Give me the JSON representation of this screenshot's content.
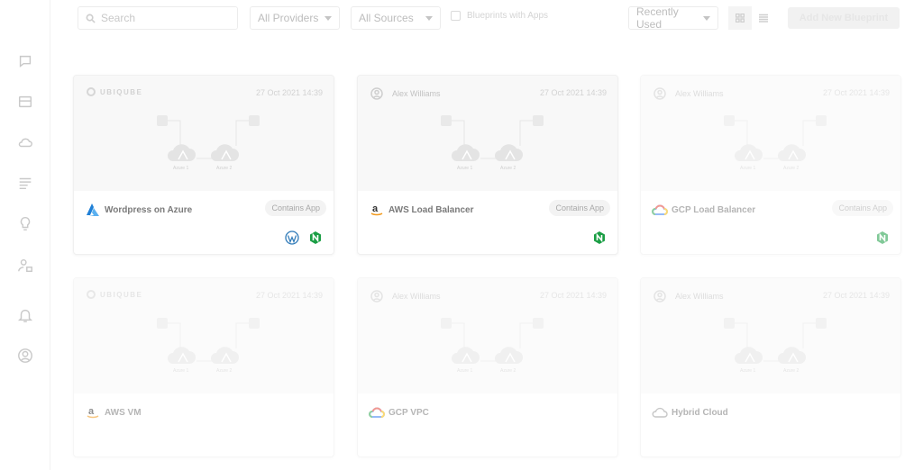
{
  "toolbar": {
    "search_placeholder": "Search",
    "providers_value": "All Providers",
    "sources_value": "All Sources",
    "checkbox_label": "Blueprints with Apps",
    "sort_value": "Recently Used",
    "add_button_label": "Add New Blueprint"
  },
  "sidebar": {
    "icons": [
      "chat-icon",
      "inbox-icon",
      "cloud-icon",
      "list-icon",
      "lightbulb-icon",
      "user-lock-icon",
      "bell-icon",
      "account-icon"
    ]
  },
  "diagram": {
    "node1_label": "Azure 1",
    "node2_label": "Azure 2"
  },
  "cards": [
    {
      "owner": "UBIQUBE",
      "owner_type": "logo",
      "date": "27 Oct 2021 14:39",
      "name": "Wordpress on Azure",
      "provider": "azure",
      "badge": "Contains App",
      "apps": [
        "wordpress",
        "nginx"
      ]
    },
    {
      "owner": "Alex Williams",
      "owner_type": "user",
      "date": "27 Oct 2021 14:39",
      "name": "AWS Load Balancer",
      "provider": "aws",
      "badge": "Contains App",
      "apps": [
        "nginx"
      ]
    },
    {
      "owner": "Alex Williams",
      "owner_type": "user",
      "date": "27 Oct 2021 14:39",
      "name": "GCP Load Balancer",
      "provider": "gcp",
      "badge": "Contains App",
      "apps": [
        "nginx"
      ]
    },
    {
      "owner": "UBIQUBE",
      "owner_type": "logo",
      "date": "27 Oct 2021 14:39",
      "name": "AWS VM",
      "provider": "aws",
      "badge": "",
      "apps": []
    },
    {
      "owner": "Alex Williams",
      "owner_type": "user",
      "date": "27 Oct 2021 14:39",
      "name": "GCP VPC",
      "provider": "gcp",
      "badge": "",
      "apps": []
    },
    {
      "owner": "Alex Williams",
      "owner_type": "user",
      "date": "27 Oct 2021 14:39",
      "name": "Hybrid Cloud",
      "provider": "hybrid",
      "badge": "",
      "apps": []
    }
  ],
  "colors": {
    "azure": "#1f7fd6",
    "aws_orange": "#f29a1d",
    "nginx": "#1b9e45",
    "wordpress": "#2f7ab8"
  }
}
